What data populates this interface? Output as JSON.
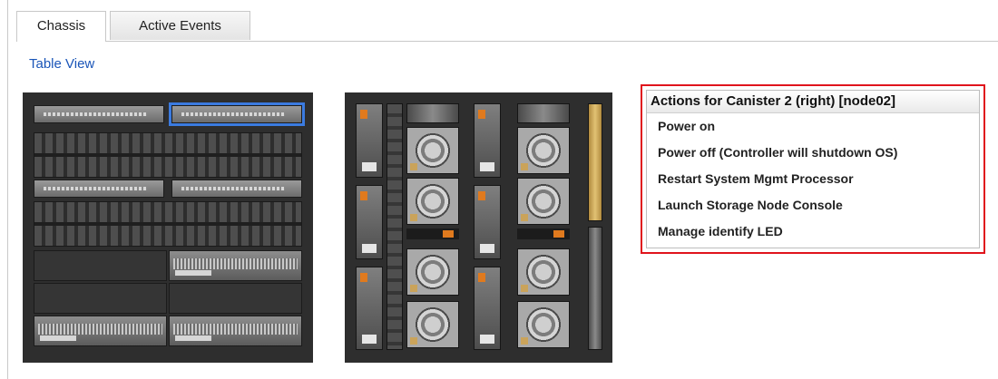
{
  "tabs": [
    {
      "label": "Chassis",
      "active": true
    },
    {
      "label": "Active Events",
      "active": false
    }
  ],
  "table_view_link": "Table View",
  "actions_menu": {
    "title": "Actions for Canister 2 (right) [node02]",
    "items": [
      "Power on",
      "Power off (Controller will shutdown OS)",
      "Restart System Mgmt Processor",
      "Launch Storage Node Console",
      "Manage identify LED"
    ]
  },
  "colors": {
    "selection_outline": "#3b7be0",
    "highlight_box": "#e0141c",
    "link": "#1a55b8",
    "chassis_bg": "#2e2e2e"
  }
}
